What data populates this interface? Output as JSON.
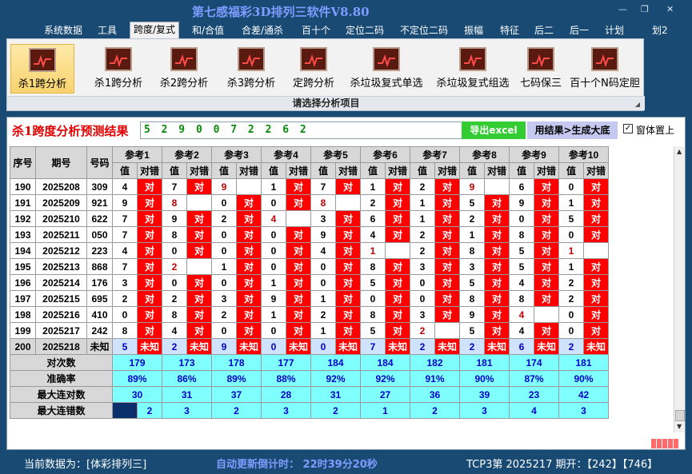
{
  "app": {
    "title": "第七感福彩3D排列三软件V8.80",
    "minimize": "—",
    "restore": "❐",
    "close": "✕"
  },
  "menu": {
    "items": [
      "系统数据",
      "工具",
      "跨度/复式",
      "和/合值",
      "合差/通杀",
      "百十个",
      "定位二码",
      "不定位二码",
      "振幅",
      "特征",
      "后二",
      "后一",
      "计划",
      "划2"
    ],
    "active_index": 2
  },
  "ribbon": {
    "buttons": [
      "杀1跨分析",
      "杀1跨分析",
      "杀2跨分析",
      "杀3跨分析",
      "定跨分析",
      "杀垃圾复式单选",
      "杀垃圾复式组选",
      "七码保三",
      "百十个N码定胆"
    ],
    "selected_index": 0,
    "icon": "chart-icon",
    "caption": "请选择分析项目"
  },
  "result": {
    "title": "杀1跨度分析预测结果",
    "value": "5 2 9 0 0 7 2 2 6 2",
    "export_label": "导出excel",
    "generate_label": "用结果>生成大底",
    "ontop_label": "窗体置上",
    "ontop_checked": "✓"
  },
  "table": {
    "headers": {
      "index": "序号",
      "period": "期号",
      "number": "号码",
      "refs": [
        "参考1",
        "参考2",
        "参考3",
        "参考4",
        "参考5",
        "参考6",
        "参考7",
        "参考8",
        "参考9",
        "参考10"
      ],
      "val": "值",
      "result": "对错"
    },
    "rows": [
      {
        "index": "190",
        "period": "2025208",
        "number": "309",
        "cells": [
          [
            "4",
            "对"
          ],
          [
            "7",
            "对"
          ],
          [
            "9",
            ""
          ],
          [
            "1",
            "对"
          ],
          [
            "7",
            "对"
          ],
          [
            "1",
            "对"
          ],
          [
            "2",
            "对"
          ],
          [
            "9",
            ""
          ],
          [
            "6",
            "对"
          ],
          [
            "0",
            "对"
          ]
        ],
        "hl": [
          2,
          7
        ]
      },
      {
        "index": "191",
        "period": "2025209",
        "number": "921",
        "cells": [
          [
            "9",
            "对"
          ],
          [
            "8",
            ""
          ],
          [
            "0",
            "对"
          ],
          [
            "0",
            "对"
          ],
          [
            "8",
            ""
          ],
          [
            "2",
            "对"
          ],
          [
            "1",
            "对"
          ],
          [
            "5",
            "对"
          ],
          [
            "9",
            "对"
          ],
          [
            "1",
            "对"
          ]
        ],
        "hl": [
          1,
          4
        ]
      },
      {
        "index": "192",
        "period": "2025210",
        "number": "622",
        "cells": [
          [
            "7",
            "对"
          ],
          [
            "9",
            "对"
          ],
          [
            "2",
            "对"
          ],
          [
            "4",
            ""
          ],
          [
            "3",
            "对"
          ],
          [
            "6",
            "对"
          ],
          [
            "1",
            "对"
          ],
          [
            "2",
            "对"
          ],
          [
            "0",
            "对"
          ],
          [
            "5",
            "对"
          ]
        ],
        "hl": [
          3
        ]
      },
      {
        "index": "193",
        "period": "2025211",
        "number": "050",
        "cells": [
          [
            "7",
            "对"
          ],
          [
            "8",
            "对"
          ],
          [
            "0",
            "对"
          ],
          [
            "0",
            "对"
          ],
          [
            "9",
            "对"
          ],
          [
            "4",
            "对"
          ],
          [
            "2",
            "对"
          ],
          [
            "1",
            "对"
          ],
          [
            "8",
            "对"
          ],
          [
            "0",
            "对"
          ]
        ],
        "hl": []
      },
      {
        "index": "194",
        "period": "2025212",
        "number": "223",
        "cells": [
          [
            "4",
            "对"
          ],
          [
            "0",
            "对"
          ],
          [
            "0",
            "对"
          ],
          [
            "0",
            "对"
          ],
          [
            "4",
            "对"
          ],
          [
            "1",
            ""
          ],
          [
            "2",
            "对"
          ],
          [
            "8",
            "对"
          ],
          [
            "5",
            "对"
          ],
          [
            "1",
            ""
          ]
        ],
        "hl": [
          5,
          9
        ]
      },
      {
        "index": "195",
        "period": "2025213",
        "number": "868",
        "cells": [
          [
            "7",
            "对"
          ],
          [
            "2",
            ""
          ],
          [
            "1",
            "对"
          ],
          [
            "0",
            "对"
          ],
          [
            "0",
            "对"
          ],
          [
            "8",
            "对"
          ],
          [
            "3",
            "对"
          ],
          [
            "3",
            "对"
          ],
          [
            "5",
            "对"
          ],
          [
            "1",
            "对"
          ]
        ],
        "hl": [
          1
        ]
      },
      {
        "index": "196",
        "period": "2025214",
        "number": "176",
        "cells": [
          [
            "3",
            "对"
          ],
          [
            "0",
            "对"
          ],
          [
            "0",
            "对"
          ],
          [
            "1",
            "对"
          ],
          [
            "0",
            "对"
          ],
          [
            "5",
            "对"
          ],
          [
            "0",
            "对"
          ],
          [
            "5",
            "对"
          ],
          [
            "4",
            "对"
          ],
          [
            "2",
            "对"
          ]
        ],
        "hl": []
      },
      {
        "index": "197",
        "period": "2025215",
        "number": "695",
        "cells": [
          [
            "2",
            "对"
          ],
          [
            "2",
            "对"
          ],
          [
            "3",
            "对"
          ],
          [
            "9",
            "对"
          ],
          [
            "1",
            "对"
          ],
          [
            "0",
            "对"
          ],
          [
            "0",
            "对"
          ],
          [
            "8",
            "对"
          ],
          [
            "8",
            "对"
          ],
          [
            "2",
            "对"
          ]
        ],
        "hl": []
      },
      {
        "index": "198",
        "period": "2025216",
        "number": "410",
        "cells": [
          [
            "0",
            "对"
          ],
          [
            "8",
            "对"
          ],
          [
            "2",
            "对"
          ],
          [
            "1",
            "对"
          ],
          [
            "2",
            "对"
          ],
          [
            "8",
            "对"
          ],
          [
            "3",
            "对"
          ],
          [
            "9",
            "对"
          ],
          [
            "4",
            ""
          ],
          [
            "0",
            "对"
          ]
        ],
        "hl": [
          8
        ]
      },
      {
        "index": "199",
        "period": "2025217",
        "number": "242",
        "cells": [
          [
            "8",
            "对"
          ],
          [
            "4",
            "对"
          ],
          [
            "0",
            "对"
          ],
          [
            "0",
            "对"
          ],
          [
            "1",
            "对"
          ],
          [
            "5",
            "对"
          ],
          [
            "2",
            ""
          ],
          [
            "5",
            "对"
          ],
          [
            "4",
            "对"
          ],
          [
            "0",
            "对"
          ]
        ],
        "hl": [
          6
        ]
      },
      {
        "index": "200",
        "period": "2025218",
        "number": "未知",
        "cells": [
          [
            "5",
            "未知"
          ],
          [
            "2",
            "未知"
          ],
          [
            "9",
            "未知"
          ],
          [
            "0",
            "未知"
          ],
          [
            "0",
            "未知"
          ],
          [
            "7",
            "未知"
          ],
          [
            "2",
            "未知"
          ],
          [
            "2",
            "未知"
          ],
          [
            "6",
            "未知"
          ],
          [
            "2",
            "未知"
          ]
        ],
        "hl": [],
        "unknown": true
      }
    ],
    "stats": [
      {
        "label": "对次数",
        "values": [
          "179",
          "173",
          "178",
          "177",
          "184",
          "184",
          "182",
          "181",
          "174",
          "181"
        ]
      },
      {
        "label": "准确率",
        "values": [
          "89%",
          "86%",
          "89%",
          "88%",
          "92%",
          "92%",
          "91%",
          "90%",
          "87%",
          "90%"
        ]
      },
      {
        "label": "最大连对数",
        "values": [
          "30",
          "31",
          "37",
          "28",
          "31",
          "27",
          "36",
          "39",
          "23",
          "42"
        ]
      },
      {
        "label": "最大连错数",
        "values": [
          "2",
          "3",
          "2",
          "3",
          "2",
          "1",
          "2",
          "3",
          "4",
          "3"
        ]
      }
    ]
  },
  "status": {
    "current_data": "当前数据为：[体彩排列三]",
    "countdown": "自动更新倒计时：  22时39分20秒",
    "period_info": "TCP3第 2025217 期开：【242】【746】"
  }
}
